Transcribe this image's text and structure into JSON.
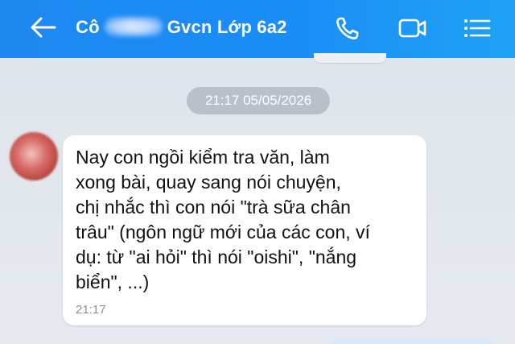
{
  "header": {
    "title_prefix": "Cô",
    "title_suffix": "Gvcn Lớp 6a2",
    "icons": [
      "back-arrow-icon",
      "phone-icon",
      "video-call-icon",
      "menu-list-icon"
    ],
    "colors": {
      "bar": "#1a8df7",
      "icon": "#ffffff"
    }
  },
  "conversation": {
    "date_separator": "21:17 05/05/2026",
    "message": {
      "lines": [
        "Nay con ngồi kiểm tra văn, làm",
        "xong bài, quay sang nói chuyện,",
        "chị nhắc thì con nói \"trà sữa chân",
        "trâu\" (ngôn ngữ mới của các con, ví",
        "dụ: từ \"ai hỏi\" thì nói \"oishi\", \"nắng",
        "biển\", ...)"
      ],
      "time": "21:17"
    }
  }
}
